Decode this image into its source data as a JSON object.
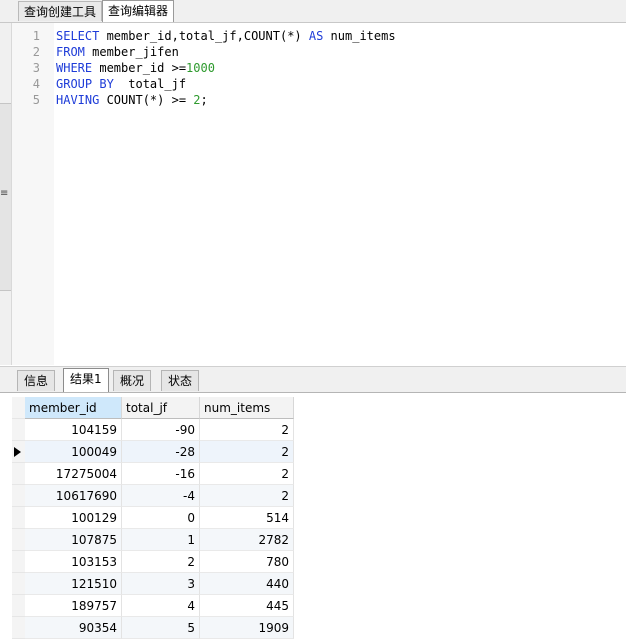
{
  "tabs": [
    "查询创建工具",
    "查询编辑器"
  ],
  "active_tab": 1,
  "editor": {
    "lines": [
      {
        "no": "1",
        "tokens": [
          {
            "t": "SELECT",
            "c": "kw"
          },
          {
            "t": " member_id,total_jf,COUNT(*) ",
            "c": ""
          },
          {
            "t": "AS",
            "c": "kw"
          },
          {
            "t": " num_items",
            "c": ""
          }
        ]
      },
      {
        "no": "2",
        "tokens": [
          {
            "t": "FROM",
            "c": "kw"
          },
          {
            "t": " member_jifen",
            "c": ""
          }
        ]
      },
      {
        "no": "3",
        "tokens": [
          {
            "t": "WHERE",
            "c": "kw"
          },
          {
            "t": " member_id >=",
            "c": ""
          },
          {
            "t": "1000",
            "c": "num"
          }
        ]
      },
      {
        "no": "4",
        "tokens": [
          {
            "t": "GROUP BY",
            "c": "kw"
          },
          {
            "t": "  total_jf",
            "c": ""
          }
        ]
      },
      {
        "no": "5",
        "tokens": [
          {
            "t": "HAVING",
            "c": "kw"
          },
          {
            "t": " COUNT(*) >= ",
            "c": ""
          },
          {
            "t": "2",
            "c": "num"
          },
          {
            "t": ";",
            "c": ""
          }
        ]
      }
    ]
  },
  "result_tabs": [
    "信息",
    "结果1",
    "概况",
    "状态"
  ],
  "active_result_tab": 1,
  "grid": {
    "columns": [
      "member_id",
      "total_jf",
      "num_items"
    ],
    "rows": [
      [
        "104159",
        "-90",
        "2"
      ],
      [
        "100049",
        "-28",
        "2"
      ],
      [
        "17275004",
        "-16",
        "2"
      ],
      [
        "10617690",
        "-4",
        "2"
      ],
      [
        "100129",
        "0",
        "514"
      ],
      [
        "107875",
        "1",
        "2782"
      ],
      [
        "103153",
        "2",
        "780"
      ],
      [
        "121510",
        "3",
        "440"
      ],
      [
        "189757",
        "4",
        "445"
      ],
      [
        "90354",
        "5",
        "1909"
      ]
    ],
    "current_row": 1
  }
}
